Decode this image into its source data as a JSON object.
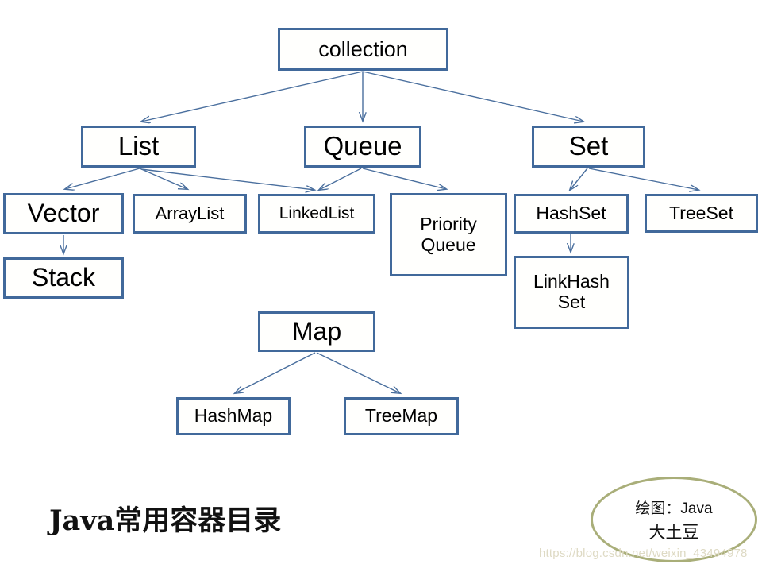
{
  "diagram": {
    "title": "Java常用容器目录",
    "nodes": {
      "collection": "collection",
      "list": "List",
      "queue": "Queue",
      "set": "Set",
      "vector": "Vector",
      "stack": "Stack",
      "arraylist": "ArrayList",
      "linkedlist": "LinkedList",
      "priorityqueue": "Priority\nQueue",
      "hashset": "HashSet",
      "treeset": "TreeSet",
      "linkhashset": "LinkHash\nSet",
      "map": "Map",
      "hashmap": "HashMap",
      "treemap": "TreeMap"
    },
    "edges": [
      {
        "from": "collection",
        "to": "list"
      },
      {
        "from": "collection",
        "to": "queue"
      },
      {
        "from": "collection",
        "to": "set"
      },
      {
        "from": "list",
        "to": "vector"
      },
      {
        "from": "list",
        "to": "arraylist"
      },
      {
        "from": "list",
        "to": "linkedlist"
      },
      {
        "from": "vector",
        "to": "stack"
      },
      {
        "from": "queue",
        "to": "linkedlist"
      },
      {
        "from": "queue",
        "to": "priorityqueue"
      },
      {
        "from": "set",
        "to": "hashset"
      },
      {
        "from": "set",
        "to": "treeset"
      },
      {
        "from": "hashset",
        "to": "linkhashset"
      },
      {
        "from": "map",
        "to": "hashmap"
      },
      {
        "from": "map",
        "to": "treemap"
      }
    ],
    "colors": {
      "box_border": "#41699b",
      "box_fill": "#fffffd",
      "edge": "#4a6f9e",
      "oval_border": "#a9ae79",
      "watermark": "#dedac4",
      "text": "#000000"
    }
  },
  "credit": {
    "line1": "绘图：Java",
    "line2": "大土豆"
  },
  "watermark": {
    "text": "https://blog.csdn.net/weixin_43494978"
  }
}
